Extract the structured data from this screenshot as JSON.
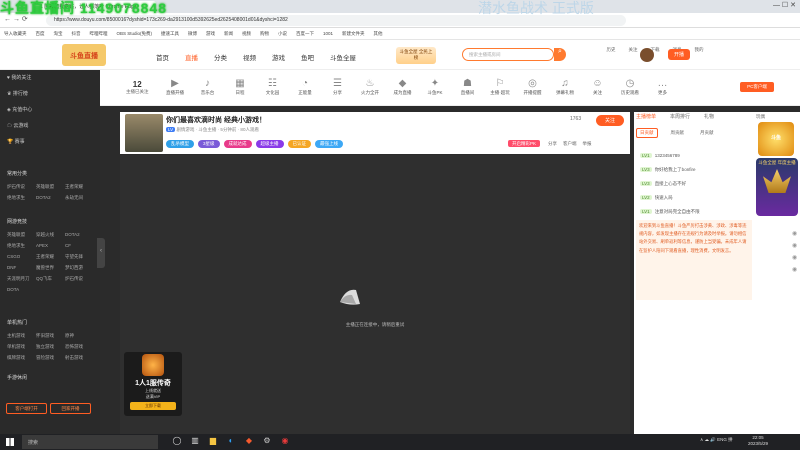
{
  "browser": {
    "tab_title": "1 阿锐加我老铁，让人都落叶 Chrome Edge",
    "url": "https://www.douyu.com/8500016?dyshid=173c269-da2913100d5392625ed2625408001d01&dyshci=1282",
    "bookmarks": [
      "导入收藏夹",
      "百度",
      "淘宝",
      "抖音",
      "哔哩哔哩",
      "OBS Studio(免费)",
      "捷速工具",
      "微博",
      "游戏",
      "新闻",
      "视频",
      "购物",
      "小说",
      "百度一下",
      "1001",
      "新建文件夹",
      "其他"
    ],
    "window_controls": "—  ☐  ✕"
  },
  "overlay": {
    "watermark_left": "斗鱼直播间 1149078848",
    "watermark_right": "潜水鱼战术 正式版"
  },
  "site": {
    "logo_text": "斗鱼直播",
    "nav": [
      "首页",
      "直播",
      "分类",
      "视频",
      "游戏",
      "鱼吧",
      "斗鱼全屋"
    ],
    "nav_active": 1,
    "promo": "斗鱼全屋 全民上榜",
    "search_placeholder": "搜索主播或房间",
    "header_icons": [
      "历史",
      "关注",
      "下载",
      "消息",
      "我的"
    ],
    "open_btn": "开播"
  },
  "sidebar": {
    "top_items": [
      "我的关注",
      "排行榜",
      "充值中心",
      "云游戏",
      "赛事"
    ],
    "section1": "常用分类",
    "grid1": [
      "炉石传说",
      "英雄联盟",
      "王者荣耀",
      "绝地求生",
      "DOTA2",
      "永劫无间"
    ],
    "section2": "网游竞技",
    "grid2": [
      "英雄联盟",
      "穿越火线",
      "DOTA2",
      "绝地求生",
      "APEX",
      "CF",
      "CSGO",
      "王者荣耀",
      "守望先锋",
      "DNF",
      "魔兽世界",
      "梦幻西游",
      "天涯明月刀",
      "QQ飞车",
      "炉石传说",
      "DOTA"
    ],
    "section3": "单机热门",
    "grid3": [
      "主机游戏",
      "怀旧游戏",
      "原神",
      "单机游戏",
      "独立游戏",
      "恐怖游戏",
      "棋牌游戏",
      "冒险游戏",
      "射击游戏"
    ],
    "section4": "手游休闲",
    "buttons": [
      "客户端打开",
      "回家开播"
    ]
  },
  "catstrip": {
    "follow_count": "12",
    "follow_label": "主播已关注",
    "items": [
      {
        "icon": "▶",
        "label": "直播开播"
      },
      {
        "icon": "♪",
        "label": "音乐台"
      },
      {
        "icon": "▦",
        "label": "日程"
      },
      {
        "icon": "☷",
        "label": "文化园"
      },
      {
        "icon": "◔",
        "label": "正能量"
      },
      {
        "icon": "☰",
        "label": "分享"
      },
      {
        "icon": "♨",
        "label": "火力全开"
      },
      {
        "icon": "◆",
        "label": "成为直播"
      },
      {
        "icon": "✦",
        "label": "斗鱼PK"
      },
      {
        "icon": "☗",
        "label": "直播间"
      },
      {
        "icon": "⚐",
        "label": "主播·超玩"
      },
      {
        "icon": "◎",
        "label": "开播提醒"
      },
      {
        "icon": "♫",
        "label": "弹幕礼物"
      },
      {
        "icon": "☺",
        "label": "关注"
      },
      {
        "icon": "◷",
        "label": "历史观看"
      },
      {
        "icon": "…",
        "label": "更多"
      }
    ],
    "pc_app": "PC客户端"
  },
  "room": {
    "title": "你们最喜欢滴时尚 经典小游戏！",
    "level": "LV",
    "meta": "剧情游戏 · 斗鱼主播 · 5分钟前 · 80人观看",
    "tags": [
      {
        "text": "乱杀模型",
        "color": "#2fa0e8"
      },
      {
        "text": "3星级",
        "color": "#7a5ad8"
      },
      {
        "text": "成就达成",
        "color": "#e83a8a"
      },
      {
        "text": "超级主播",
        "color": "#8a3ae8"
      },
      {
        "text": "已认证",
        "color": "#f5a623"
      },
      {
        "text": "最强上线",
        "color": "#3da8f5"
      }
    ],
    "follow_count": "1763",
    "follow_btn": "关注",
    "pk_btn": "开启精彩PK",
    "actions": [
      "分享",
      "客户端",
      "举报"
    ]
  },
  "player": {
    "loading_text": "主播正在连接中，请稍后重试"
  },
  "game_ad": {
    "title": "1人1服传奇",
    "line1": "上线就送",
    "line2": "送满VIP",
    "download": "立即下载"
  },
  "chat": {
    "tabs": [
      "主播榜单",
      "本周排行",
      "礼物"
    ],
    "tab_active": 0,
    "sub_tabs": [
      "日贡献",
      "周贡献",
      "月贡献"
    ],
    "messages": [
      {
        "badge": "LV1",
        "text": "1323456789"
      },
      {
        "badge": "LV3",
        "text": "你好给我上了bonfire"
      },
      {
        "badge": "LV3",
        "text": "直接上心态不好"
      },
      {
        "badge": "LV2",
        "text": "快速入局"
      },
      {
        "badge": "LV1",
        "text": "注意对局完全自由不限"
      }
    ],
    "notice": "欢迎来到斗鱼直播！斗鱼严厉打击涉黄、涉政、涉毒等违规内容，如发现主播存在违规行为请及时举报。请勿相信站外交易、刷单返利等信息，谨防上当受骗。未成年人请在监护人陪同下观看直播，理性消费，文明发言。"
  },
  "right_panel": {
    "tab": "玩偶",
    "badge1": "斗鱼",
    "badge2": "斗鱼全屋 年度主播"
  },
  "taskbar": {
    "search": "搜索",
    "tray": "∧  ☁  🔊  ENG  拼",
    "time": "22:05",
    "date": "2023/5/29"
  }
}
